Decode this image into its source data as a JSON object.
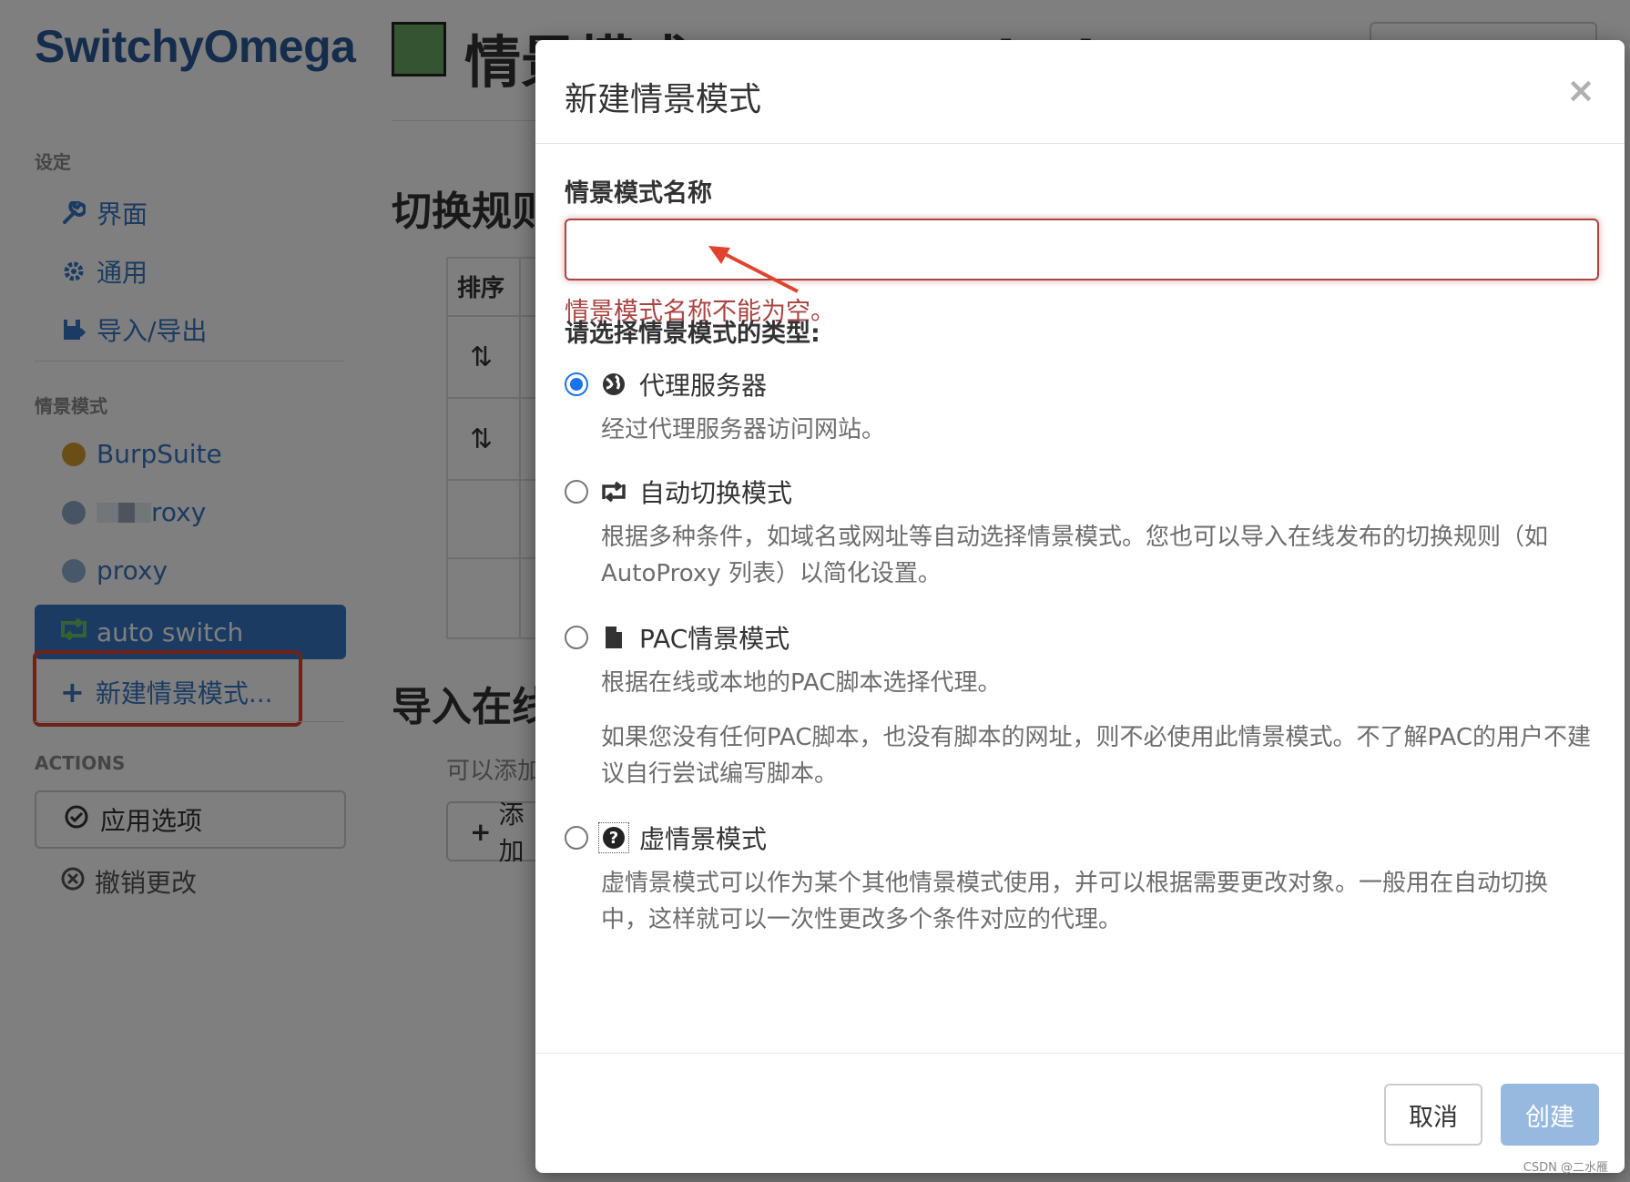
{
  "app": {
    "brand": "SwitchyOmega",
    "page_title": "情景模式：auto switch",
    "section_rules": "切换规则",
    "section_import": "导入在线规则列表",
    "import_hint": "可以添加",
    "add_button": "添加",
    "table_col_order": "排序",
    "sort_glyph": "⇅"
  },
  "sidebar": {
    "settings_header": "设定",
    "settings_items": [
      {
        "label": "界面",
        "icon": "wrench-icon"
      },
      {
        "label": "通用",
        "icon": "gear-icon"
      },
      {
        "label": "导入/导出",
        "icon": "save-icon"
      }
    ],
    "profiles_header": "情景模式",
    "profiles": [
      {
        "label": "BurpSuite",
        "color": "#d79b2c"
      },
      {
        "label": "roxy",
        "color": "#8ea9c6"
      },
      {
        "label": "proxy",
        "color": "#8fb1d6"
      }
    ],
    "active_profile": "auto switch",
    "new_profile": "新建情景模式...",
    "actions_header": "ACTIONS",
    "apply": "应用选项",
    "discard": "撤销更改"
  },
  "modal": {
    "title": "新建情景模式",
    "close": "×",
    "name_label": "情景模式名称",
    "name_value": "",
    "name_error": "情景模式名称不能为空。",
    "type_label": "请选择情景模式的类型:",
    "options": [
      {
        "label": "代理服务器",
        "icon": "globe-icon",
        "selected": true,
        "desc": [
          "经过代理服务器访问网站。"
        ]
      },
      {
        "label": "自动切换模式",
        "icon": "retweet-icon",
        "selected": false,
        "desc": [
          "根据多种条件，如域名或网址等自动选择情景模式。您也可以导入在线发布的切换规则（如 AutoProxy 列表）以简化设置。"
        ]
      },
      {
        "label": "PAC情景模式",
        "icon": "file-icon",
        "selected": false,
        "desc": [
          "根据在线或本地的PAC脚本选择代理。",
          "如果您没有任何PAC脚本，也没有脚本的网址，则不必使用此情景模式。不了解PAC的用户不建议自行尝试编写脚本。"
        ]
      },
      {
        "label": "虚情景模式",
        "icon": "question-icon",
        "selected": false,
        "desc": [
          "虚情景模式可以作为某个其他情景模式使用，并可以根据需要更改对象。一般用在自动切换中，这样就可以一次性更改多个条件对应的代理。"
        ]
      }
    ],
    "cancel": "取消",
    "create": "创建"
  },
  "colors": {
    "brand": "#2a5a99",
    "accent": "#3676c4",
    "error": "#a94442",
    "create_disabled": "#98b9df",
    "annotation": "#e0442e"
  },
  "watermark": "CSDN @二水雁"
}
